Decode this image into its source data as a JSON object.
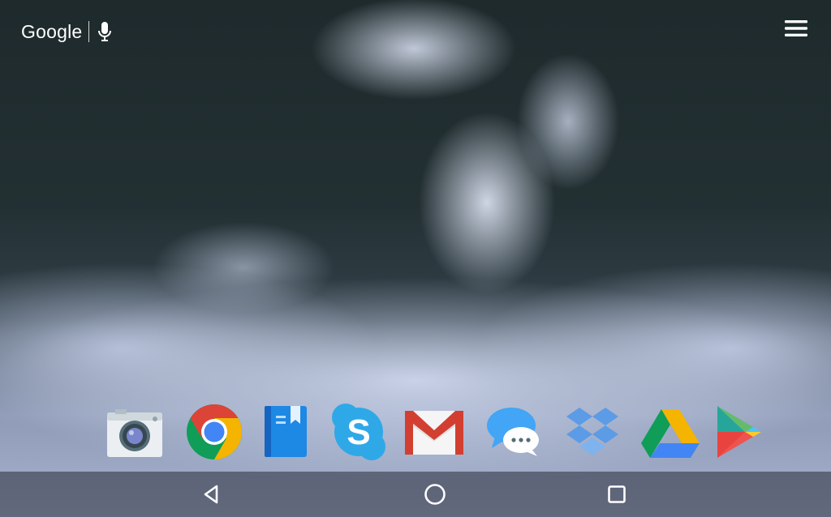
{
  "search_widget": {
    "logo_text": "Google",
    "mic_icon": "microphone-icon"
  },
  "top_right": {
    "menu_icon": "hamburger-menu-icon"
  },
  "dock": {
    "apps": [
      {
        "name": "Camera",
        "icon": "camera-icon"
      },
      {
        "name": "Chrome",
        "icon": "chrome-icon"
      },
      {
        "name": "Play Books",
        "icon": "book-icon"
      },
      {
        "name": "Skype",
        "icon": "skype-icon"
      },
      {
        "name": "Gmail",
        "icon": "gmail-icon"
      },
      {
        "name": "Messenger",
        "icon": "chat-bubble-icon"
      },
      {
        "name": "Dropbox",
        "icon": "dropbox-icon"
      },
      {
        "name": "Drive",
        "icon": "google-drive-icon"
      },
      {
        "name": "Play Store",
        "icon": "play-store-icon"
      }
    ]
  },
  "navigation": {
    "back_icon": "back-triangle-icon",
    "home_icon": "home-circle-icon",
    "recents_icon": "recents-square-icon"
  },
  "colors": {
    "chrome_red": "#db4437",
    "chrome_yellow": "#f4b400",
    "chrome_green": "#0f9d58",
    "chrome_blue": "#4285f4",
    "skype_blue": "#2fa8e8",
    "gmail_red": "#d23f31",
    "dropbox_blue": "#5c9be6"
  }
}
